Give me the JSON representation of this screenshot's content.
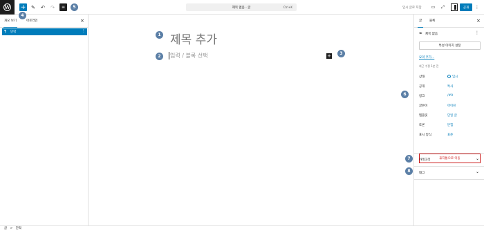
{
  "toolbar": {
    "logo_letter": "W",
    "add_icon": "+",
    "edit_icon": "✎",
    "undo_icon": "↶",
    "redo_icon": "↷",
    "overview_icon": "≡",
    "command_label": "제목 없음 · 글",
    "command_shortcut": "Ctrl+K",
    "save_draft": "임시 글로 저장",
    "publish": "공개"
  },
  "left_panel": {
    "tab_list": "개요 보기",
    "tab_outline": "아웃라인",
    "close": "×",
    "block_row": "단락",
    "block_icon": "¶",
    "block_more": "⋮"
  },
  "editor": {
    "title_placeholder": "제목 추가",
    "paragraph_placeholder": "입력 / 블록 선택",
    "inserter": "+"
  },
  "right_panel": {
    "tab_post": "글",
    "tab_block": "블록",
    "close": "×",
    "post_title": "제목 없음",
    "more": "⋮",
    "featured_image_button": "특성 이미지 설정",
    "excerpt_link": "요약 추가...",
    "last_edited": "최근 수정 1분 전",
    "properties": [
      {
        "key": "상태",
        "value": "임시"
      },
      {
        "key": "공개",
        "value": "특사"
      },
      {
        "key": "링크",
        "value": "/#0"
      },
      {
        "key": "글쓴이",
        "value": "아이린"
      },
      {
        "key": "템플릿",
        "value": "단일 글"
      },
      {
        "key": "토론",
        "value": "닫힘"
      },
      {
        "key": "표시 방식",
        "value": "표준"
      }
    ],
    "trash_button": "휴지통으로 이동",
    "sections": [
      {
        "label": "카테고리"
      },
      {
        "label": "태그"
      }
    ]
  },
  "annotations": [
    "1",
    "2",
    "3",
    "4",
    "5",
    "6",
    "7",
    "8"
  ],
  "status_bar": {
    "breadcrumb_1": "글",
    "separator": ">",
    "breadcrumb_2": "단락"
  }
}
